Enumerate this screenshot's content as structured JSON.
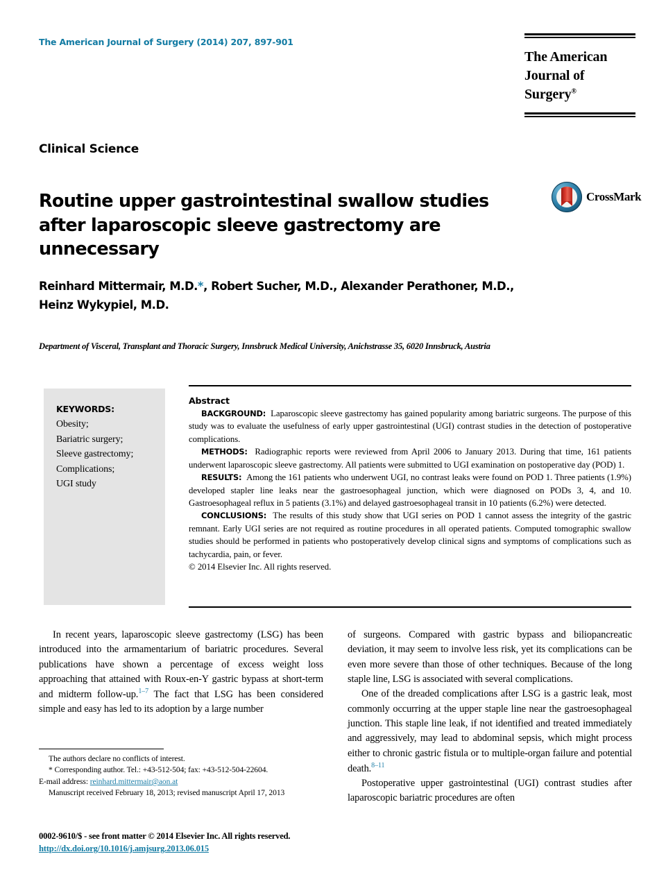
{
  "masthead": {
    "journal_reference": "The American Journal of Surgery (2014) 207, 897-901",
    "logo_line1": "The American",
    "logo_line2": "Journal of Surgery",
    "logo_registered": "®"
  },
  "article": {
    "section_label": "Clinical Science",
    "title": "Routine upper gastrointestinal swallow studies after laparoscopic sleeve gastrectomy are unnecessary",
    "authors_line1_a": "Reinhard Mittermair, M.D.",
    "authors_star": "*",
    "authors_line1_b": ", Robert Sucher, M.D., Alexander Perathoner, M.D.,",
    "authors_line2": "Heinz Wykypiel, M.D.",
    "affiliation": "Department of Visceral, Transplant and Thoracic Surgery, Innsbruck Medical University, Anichstrasse 35, 6020 Innsbruck, Austria"
  },
  "crossmark": {
    "label": "CrossMark"
  },
  "keywords": {
    "title": "KEYWORDS:",
    "items": [
      "Obesity;",
      "Bariatric surgery;",
      "Sleeve gastrectomy;",
      "Complications;",
      "UGI study"
    ]
  },
  "abstract": {
    "heading": "Abstract",
    "background_label": "BACKGROUND:",
    "background_text": "Laparoscopic sleeve gastrectomy has gained popularity among bariatric surgeons. The purpose of this study was to evaluate the usefulness of early upper gastrointestinal (UGI) contrast studies in the detection of postoperative complications.",
    "methods_label": "METHODS:",
    "methods_text": "Radiographic reports were reviewed from April 2006 to January 2013. During that time, 161 patients underwent laparoscopic sleeve gastrectomy. All patients were submitted to UGI examination on postoperative day (POD) 1.",
    "results_label": "RESULTS:",
    "results_text": "Among the 161 patients who underwent UGI, no contrast leaks were found on POD 1. Three patients (1.9%) developed stapler line leaks near the gastroesophageal junction, which were diagnosed on PODs 3, 4, and 10. Gastroesophageal reflux in 5 patients (3.1%) and delayed gastroesophageal transit in 10 patients (6.2%) were detected.",
    "conclusions_label": "CONCLUSIONS:",
    "conclusions_text": "The results of this study show that UGI series on POD 1 cannot assess the integrity of the gastric remnant. Early UGI series are not required as routine procedures in all operated patients. Computed tomographic swallow studies should be performed in patients who postoperatively develop clinical signs and symptoms of complications such as tachycardia, pain, or fever.",
    "copyright": "© 2014 Elsevier Inc. All rights reserved."
  },
  "body": {
    "left_col": {
      "para1_before_ref": "In recent years, laparoscopic sleeve gastrectomy (LSG) has been introduced into the armamentarium of bariatric procedures. Several publications have shown a percentage of excess weight loss approaching that attained with Roux-en-Y gastric bypass at short-term and midterm follow-up.",
      "para1_ref": "1–7",
      "para1_after_ref": " The fact that LSG has been considered simple and easy has led to its adoption by a large number"
    },
    "right_col": {
      "para1": "of surgeons. Compared with gastric bypass and biliopancreatic deviation, it may seem to involve less risk, yet its complications can be even more severe than those of other techniques. Because of the long staple line, LSG is associated with several complications.",
      "para2_before_ref": "One of the dreaded complications after LSG is a gastric leak, most commonly occurring at the upper staple line near the gastroesophageal junction. This staple line leak, if not identified and treated immediately and aggressively, may lead to abdominal sepsis, which might process either to chronic gastric fistula or to multiple-organ failure and potential death.",
      "para2_ref": "8–11",
      "para3": "Postoperative upper gastrointestinal (UGI) contrast studies after laparoscopic bariatric procedures are often"
    }
  },
  "footnotes": {
    "conflicts": "The authors declare no conflicts of interest.",
    "corresponding": "* Corresponding author. Tel.: +43-512-504; fax: +43-512-504-22604.",
    "email_label": "E-mail address: ",
    "email": "reinhard.mittermair@aon.at",
    "manuscript": "Manuscript received February 18, 2013; revised manuscript April 17, 2013"
  },
  "footer": {
    "front_matter": "0002-9610/$ - see front matter © 2014 Elsevier Inc. All rights reserved.",
    "doi": "http://dx.doi.org/10.1016/j.amjsurg.2013.06.015"
  },
  "colors": {
    "link_blue": "#127ba3",
    "accent_blue": "#1f7fa8",
    "keywords_bg": "#e4e4e4"
  }
}
